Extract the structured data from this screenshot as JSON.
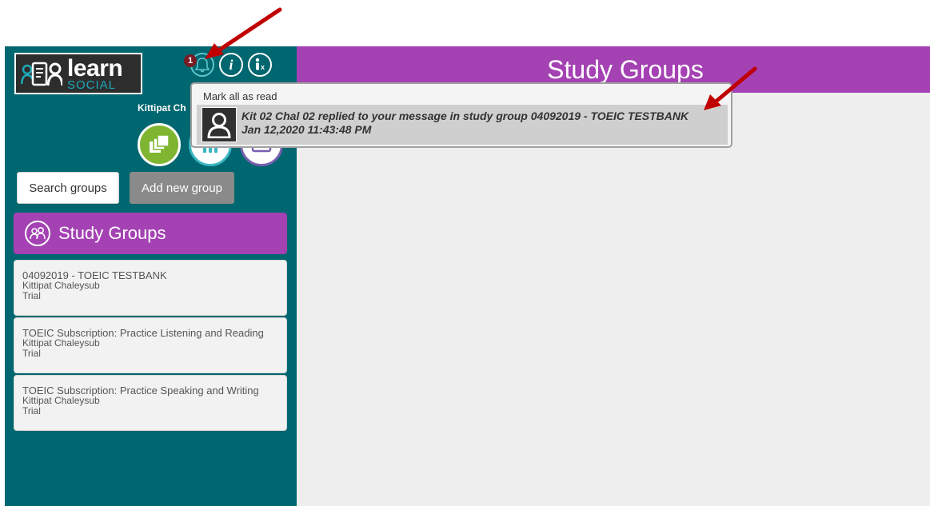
{
  "app": {
    "logo_main": "learn",
    "logo_sub": "SOCIAL",
    "username": "Kittipat Ch"
  },
  "notifications": {
    "badge_count": "1",
    "mark_all_label": "Mark all as read",
    "items": [
      {
        "message": "Kit 02 Chal 02 replied to your message in study group 04092019 - TOEIC TESTBANK",
        "timestamp": "Jan 12,2020 11:43:48 PM"
      }
    ]
  },
  "toolbar": {
    "search_label": "Search groups",
    "add_label": "Add new group"
  },
  "sidebar": {
    "header": "Study Groups",
    "groups": [
      {
        "title": "04092019 - TOEIC TESTBANK",
        "owner": "Kittipat Chaleysub",
        "status": "Trial"
      },
      {
        "title": "TOEIC Subscription: Practice Listening and Reading",
        "owner": "Kittipat Chaleysub",
        "status": "Trial"
      },
      {
        "title": "TOEIC Subscription: Practice Speaking and Writing",
        "owner": "Kittipat Chaleysub",
        "status": "Trial"
      }
    ]
  },
  "main": {
    "title": "Study Groups"
  },
  "colors": {
    "sidebar": "#00666f",
    "accent": "#a441b3",
    "annotation_arrow": "#c00000"
  }
}
